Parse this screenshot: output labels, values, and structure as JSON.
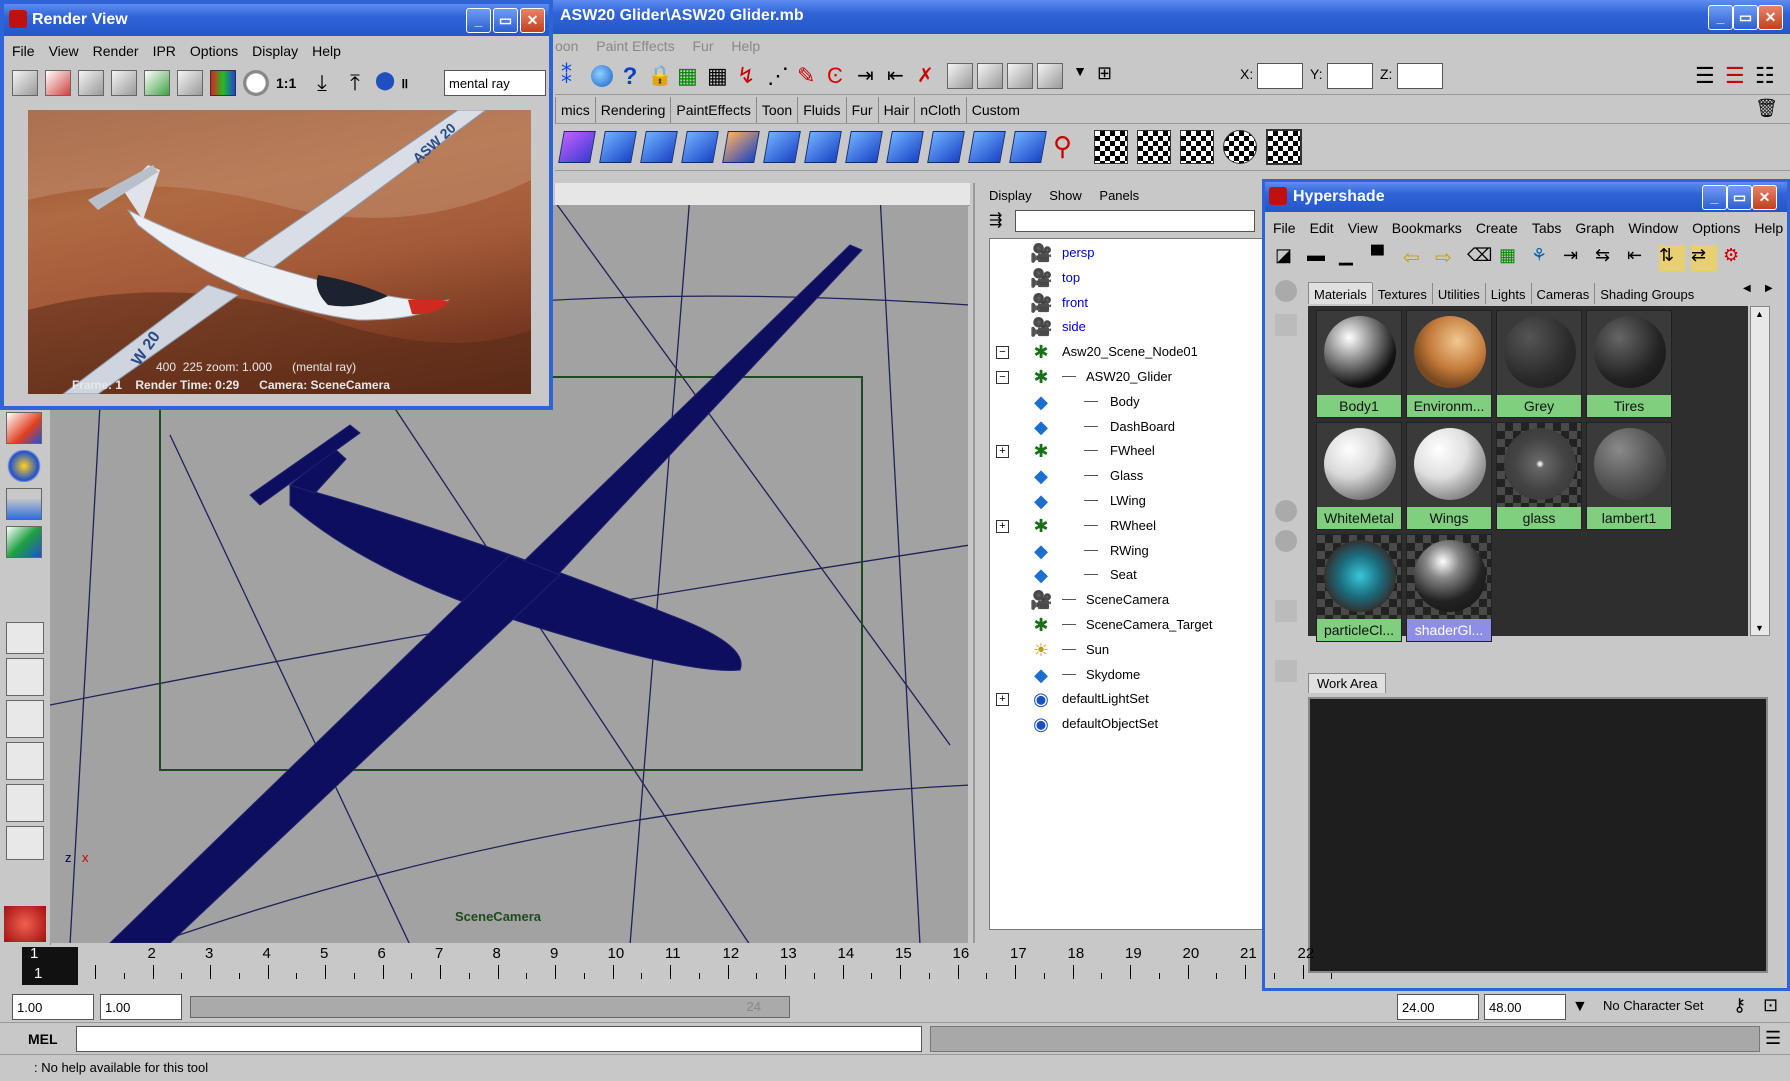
{
  "main_title": "ASW20 Glider\\ASW20 Glider.mb",
  "main_menu_visible": [
    "oon",
    "Paint Effects",
    "Fur",
    "Help"
  ],
  "coord_labels": {
    "x": "X:",
    "y": "Y:",
    "z": "Z:"
  },
  "shelf_tabs": [
    "mics",
    "Rendering",
    "PaintEffects",
    "Toon",
    "Fluids",
    "Fur",
    "Hair",
    "nCloth",
    "Custom"
  ],
  "render_view": {
    "title": "Render View",
    "menu": [
      "File",
      "View",
      "Render",
      "IPR",
      "Options",
      "Display",
      "Help"
    ],
    "ratio_label": "1:1",
    "renderer": "mental ray",
    "tail_text": "W 20",
    "wing_text": "ASW 20",
    "info_line1": "400  225 zoom: 1.000      (mental ray)",
    "info_line2": "Frame: 1    Render Time: 0:29      Camera: SceneCamera"
  },
  "viewport": {
    "camera_label": "SceneCamera",
    "axis_z": "z",
    "axis_x": "x"
  },
  "outliner": {
    "menu": [
      "Display",
      "Show",
      "Panels"
    ],
    "items": [
      {
        "name": "persp",
        "icon": "camera-icon",
        "type": "camera",
        "color": "#0000cc",
        "depth": 0,
        "expander": ""
      },
      {
        "name": "top",
        "icon": "camera-icon",
        "type": "camera",
        "color": "#0000cc",
        "depth": 0,
        "expander": ""
      },
      {
        "name": "front",
        "icon": "camera-icon",
        "type": "camera",
        "color": "#0000cc",
        "depth": 0,
        "expander": ""
      },
      {
        "name": "side",
        "icon": "camera-icon",
        "type": "camera",
        "color": "#0000cc",
        "depth": 0,
        "expander": ""
      },
      {
        "name": "Asw20_Scene_Node01",
        "icon": "group-icon",
        "type": "group",
        "color": "#000000",
        "depth": 0,
        "expander": "−"
      },
      {
        "name": "ASW20_Glider",
        "icon": "group-icon",
        "type": "group",
        "color": "#000000",
        "depth": 1,
        "expander": "−"
      },
      {
        "name": "Body",
        "icon": "mesh-icon",
        "type": "mesh",
        "color": "#000000",
        "depth": 2,
        "expander": ""
      },
      {
        "name": "DashBoard",
        "icon": "mesh-icon",
        "type": "mesh",
        "color": "#000000",
        "depth": 2,
        "expander": ""
      },
      {
        "name": "FWheel",
        "icon": "group-icon",
        "type": "group",
        "color": "#000000",
        "depth": 2,
        "expander": "+"
      },
      {
        "name": "Glass",
        "icon": "mesh-icon",
        "type": "mesh",
        "color": "#000000",
        "depth": 2,
        "expander": ""
      },
      {
        "name": "LWing",
        "icon": "mesh-icon",
        "type": "mesh",
        "color": "#000000",
        "depth": 2,
        "expander": ""
      },
      {
        "name": "RWheel",
        "icon": "group-icon",
        "type": "group",
        "color": "#000000",
        "depth": 2,
        "expander": "+"
      },
      {
        "name": "RWing",
        "icon": "mesh-icon",
        "type": "mesh",
        "color": "#000000",
        "depth": 2,
        "expander": ""
      },
      {
        "name": "Seat",
        "icon": "mesh-icon",
        "type": "mesh",
        "color": "#000000",
        "depth": 2,
        "expander": ""
      },
      {
        "name": "SceneCamera",
        "icon": "camera-icon",
        "type": "camera",
        "color": "#000000",
        "depth": 1,
        "expander": ""
      },
      {
        "name": "SceneCamera_Target",
        "icon": "group-icon",
        "type": "group",
        "color": "#000000",
        "depth": 1,
        "expander": ""
      },
      {
        "name": "Sun",
        "icon": "light-icon",
        "type": "light",
        "color": "#000000",
        "depth": 1,
        "expander": ""
      },
      {
        "name": "Skydome",
        "icon": "mesh-icon",
        "type": "mesh",
        "color": "#000000",
        "depth": 1,
        "expander": ""
      },
      {
        "name": "defaultLightSet",
        "icon": "set-icon",
        "type": "set",
        "color": "#000000",
        "depth": 0,
        "expander": "+"
      },
      {
        "name": "defaultObjectSet",
        "icon": "set-icon",
        "type": "set",
        "color": "#000000",
        "depth": 0,
        "expander": ""
      }
    ]
  },
  "hypershade": {
    "title": "Hypershade",
    "menu": [
      "File",
      "Edit",
      "View",
      "Bookmarks",
      "Create",
      "Tabs",
      "Graph",
      "Window",
      "Options",
      "Help"
    ],
    "tabs": [
      "Materials",
      "Textures",
      "Utilities",
      "Lights",
      "Cameras",
      "Shading Groups"
    ],
    "materials": [
      {
        "name": "Body1",
        "ball": "radial-gradient(circle at 35% 30%,#ffffff,#777 40%,#111 70%)",
        "selected": false
      },
      {
        "name": "Environm...",
        "ball": "radial-gradient(circle at 60% 35%,#f0c890,#c47a3a 45%,#7a4a20 70%)",
        "selected": false
      },
      {
        "name": "Grey",
        "ball": "radial-gradient(circle at 35% 30%,#555,#2a2a2a 60%,#1a1a1a)",
        "selected": false
      },
      {
        "name": "Tires",
        "ball": "radial-gradient(circle at 35% 30%,#666,#222 60%,#111)",
        "selected": false
      },
      {
        "name": "WhiteMetal",
        "ball": "radial-gradient(circle at 35% 30%,#ffffff,#d8d8d8 40%,#777 75%)",
        "selected": false
      },
      {
        "name": "Wings",
        "ball": "radial-gradient(circle at 35% 30%,#ffffff,#e0e0e0 40%,#888 75%)",
        "selected": false
      },
      {
        "name": "glass",
        "ball": "radial-gradient(circle at 50% 50%,#eee 2%,#666 8%,#444 50%,#333)",
        "selected": false
      },
      {
        "name": "lambert1",
        "ball": "radial-gradient(circle at 35% 30%,#8a8a8a,#555 50%,#2a2a2a)",
        "selected": false
      },
      {
        "name": "particleCl...",
        "ball": "radial-gradient(circle at 50% 50%,#39c6d8,#1a6f80 40%,#333 70%)",
        "selected": false
      },
      {
        "name": "shaderGl...",
        "ball": "radial-gradient(circle at 40% 30%,#fff,#888 25%,#222 60%,#111)",
        "selected": true
      }
    ],
    "work_area_label": "Work Area"
  },
  "timeline": {
    "frames": [
      "1",
      "2",
      "3",
      "4",
      "5",
      "6",
      "7",
      "8",
      "9",
      "10",
      "11",
      "12",
      "13",
      "14",
      "15",
      "16",
      "17",
      "18",
      "19",
      "20",
      "21",
      "22"
    ],
    "current_frame": "1"
  },
  "range": {
    "start": "1.00",
    "playback_start": "1.00",
    "slider_end_label": "24",
    "playback_end": "24.00",
    "end": "48.00",
    "character_set": "No Character Set"
  },
  "command_line": {
    "label": "MEL",
    "value": ""
  },
  "help_line": ": No help available for this tool"
}
